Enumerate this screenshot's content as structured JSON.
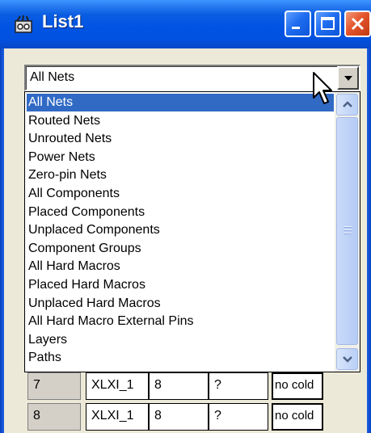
{
  "window": {
    "title": "List1",
    "icon": "list-window-icon",
    "colors": {
      "titlebar": "#0054e3",
      "selection": "#316ac5",
      "face": "#ece9d8"
    }
  },
  "combo": {
    "value": "All Nets",
    "arrow_icon": "chevron-down-icon"
  },
  "dropdown": {
    "selected_index": 0,
    "options": [
      "All Nets",
      "Routed Nets",
      "Unrouted Nets",
      "Power Nets",
      "Zero-pin Nets",
      "All Components",
      "Placed Components",
      "Unplaced Components",
      "Component Groups",
      "All Hard Macros",
      "Placed Hard Macros",
      "Unplaced Hard Macros",
      "All Hard Macro External Pins",
      "Layers",
      "Paths"
    ]
  },
  "table": {
    "rows": [
      {
        "index": "7",
        "name": "XLXI_1",
        "value": "8",
        "flag": "?",
        "color": "no cold"
      },
      {
        "index": "8",
        "name": "XLXI_1",
        "value": "8",
        "flag": "?",
        "color": "no cold"
      }
    ]
  }
}
